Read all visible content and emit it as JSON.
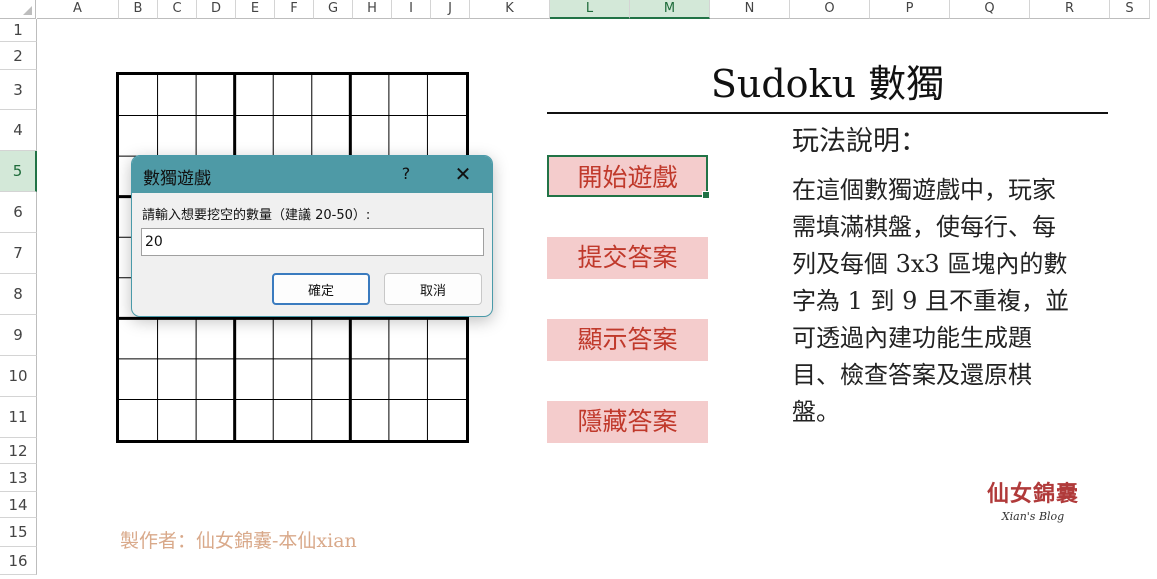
{
  "columns": [
    "A",
    "B",
    "C",
    "D",
    "E",
    "F",
    "G",
    "H",
    "I",
    "J",
    "K",
    "L",
    "M",
    "N",
    "O",
    "P",
    "Q",
    "R",
    "S"
  ],
  "selected_columns": [
    "L",
    "M"
  ],
  "rows": [
    "1",
    "2",
    "3",
    "4",
    "5",
    "6",
    "7",
    "8",
    "9",
    "10",
    "11",
    "12",
    "13",
    "14",
    "15",
    "16"
  ],
  "selected_row": "5",
  "title": "Sudoku 數獨",
  "rules": {
    "heading": "玩法說明：",
    "lines": [
      "在這個數獨遊戲中，玩家",
      "需填滿棋盤，使每行、每",
      "列及每個 3x3 區塊內的數",
      "字為 1 到 9 且不重複，並",
      "可透過內建功能生成題",
      "目、檢查答案及還原棋",
      "盤。"
    ]
  },
  "buttons": {
    "start": "開始遊戲",
    "submit": "提交答案",
    "show": "顯示答案",
    "hide": "隱藏答案"
  },
  "credit": "製作者：仙女錦囊-本仙xian",
  "logo": {
    "main": "仙女錦囊",
    "sub": "Xian's Blog"
  },
  "dialog": {
    "title": "數獨遊戲",
    "help": "?",
    "close": "✕",
    "prompt": "請輸入想要挖空的數量（建議 20-50）:",
    "input_value": "20",
    "ok": "確定",
    "cancel": "取消"
  },
  "colors": {
    "button_bg": "#f4cccc",
    "button_text": "#c0392b",
    "dialog_titlebar": "#4e9aa6",
    "selection": "#217346"
  }
}
